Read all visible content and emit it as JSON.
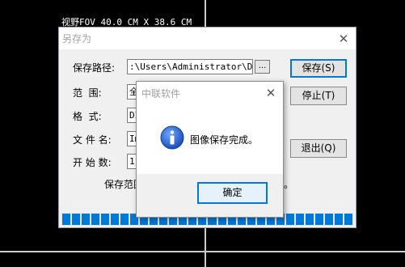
{
  "overlay": {
    "fov_text": "视野FOV 40.0 CM X 38.6 CM"
  },
  "save_dialog": {
    "title": "另存为",
    "close_glyph": "✕",
    "labels": {
      "path": "保存路径:",
      "range": "范  围:",
      "format": "格  式:",
      "filename": "文 件 名:",
      "start": "开 始 数:"
    },
    "fields": {
      "path": ":\\Users\\Administrator\\Desk",
      "range": "全",
      "format": "DI",
      "filename": "Im",
      "start": "1"
    },
    "browse_label": "...",
    "buttons": {
      "save": "保存(S)",
      "stop": "停止(T)",
      "exit": "退出(Q)"
    },
    "note_left": "保存范围",
    "note_right": "。",
    "progress_percent": 100
  },
  "message_box": {
    "title": "中联软件",
    "close_glyph": "✕",
    "icon": "info-icon",
    "message": "图像保存完成。",
    "ok_label": "确定"
  },
  "colors": {
    "accent": "#0078d7",
    "background": "#000000"
  }
}
